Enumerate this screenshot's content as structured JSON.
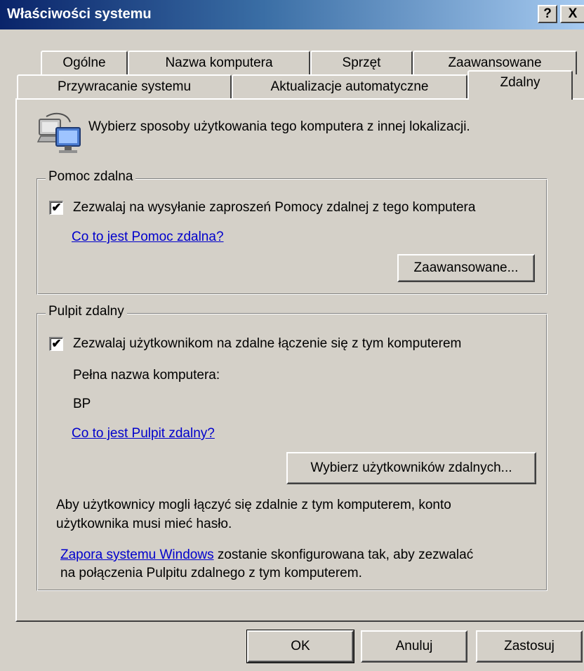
{
  "window": {
    "title": "Właściwości systemu",
    "help_glyph": "?",
    "close_glyph": "X"
  },
  "tabs_row1": [
    {
      "label": "Ogólne"
    },
    {
      "label": "Nazwa komputera"
    },
    {
      "label": "Sprzęt"
    },
    {
      "label": "Zaawansowane"
    }
  ],
  "tabs_row2": [
    {
      "label": "Przywracanie systemu"
    },
    {
      "label": "Aktualizacje automatyczne"
    },
    {
      "label": "Zdalny",
      "active": true
    }
  ],
  "intro": {
    "icon": "remote-computer-icon",
    "text": "Wybierz sposoby użytkowania tego komputera z innej lokalizacji."
  },
  "remote_assistance": {
    "legend": "Pomoc zdalna",
    "checkbox_label": "Zezwalaj na wysyłanie zaproszeń Pomocy zdalnej z tego komputera",
    "checked": true,
    "help_link": "Co to jest Pomoc zdalna?",
    "advanced_button": "Zaawansowane..."
  },
  "remote_desktop": {
    "legend": "Pulpit zdalny",
    "checkbox_label": "Zezwalaj użytkownikom na zdalne łączenie się z tym komputerem",
    "checked": true,
    "full_name_label": "Pełna nazwa komputera:",
    "computer_name": "BP",
    "help_link": "Co to jest Pulpit zdalny?",
    "select_users_button": "Wybierz użytkowników zdalnych...",
    "password_note_line1": "Aby użytkownicy mogli łączyć się zdalnie z tym komputerem, konto",
    "password_note_line2": "użytkownika musi mieć hasło.",
    "firewall_link": "Zapora systemu Windows",
    "firewall_text_line1": " zostanie skonfigurowana tak, aby zezwalać",
    "firewall_text_line2": "na połączenia Pulpitu zdalnego z tym komputerem."
  },
  "footer": {
    "ok": "OK",
    "cancel": "Anuluj",
    "apply": "Zastosuj"
  },
  "colors": {
    "titlebar_start": "#0a246a",
    "titlebar_end": "#a6caf0",
    "face": "#d4d0c8",
    "link": "#0000cc"
  }
}
